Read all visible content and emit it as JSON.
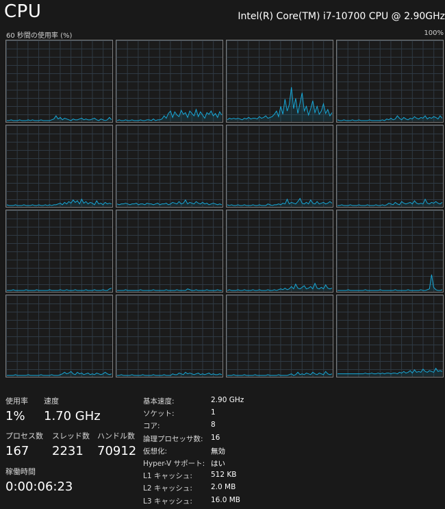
{
  "header": {
    "title": "CPU",
    "model": "Intel(R) Core(TM) i7-10700 CPU @ 2.90GHz",
    "axis_label": "60 秒間の使用率 (%)",
    "axis_max": "100%"
  },
  "colors": {
    "background": "#191919",
    "graph_line": "#17a9d9",
    "graph_border": "#7e7e7e",
    "grid_line": "#2f3a44"
  },
  "core_graphs": [
    [
      0,
      0,
      1,
      0,
      0,
      0,
      1,
      0,
      0,
      0,
      1,
      0,
      1,
      0,
      0,
      0,
      1,
      0,
      0,
      0,
      0,
      1,
      2,
      6,
      2,
      4,
      1,
      3,
      2,
      1,
      0,
      2,
      1,
      1,
      2,
      3,
      1,
      2,
      1,
      1,
      2,
      3,
      1,
      0,
      2,
      1,
      0,
      1,
      4,
      1
    ],
    [
      0,
      1,
      0,
      0,
      1,
      0,
      0,
      1,
      0,
      0,
      0,
      1,
      0,
      0,
      1,
      1,
      0,
      2,
      0,
      1,
      1,
      2,
      6,
      3,
      9,
      12,
      4,
      11,
      7,
      5,
      13,
      8,
      10,
      4,
      12,
      9,
      6,
      14,
      5,
      11,
      7,
      3,
      10,
      8,
      12,
      6,
      9,
      4,
      11,
      7
    ],
    [
      1,
      3,
      2,
      3,
      2,
      3,
      2,
      1,
      3,
      2,
      4,
      2,
      3,
      3,
      2,
      5,
      3,
      4,
      6,
      3,
      4,
      5,
      8,
      12,
      5,
      18,
      8,
      27,
      12,
      20,
      42,
      15,
      28,
      9,
      22,
      35,
      12,
      18,
      7,
      15,
      25,
      10,
      18,
      8,
      12,
      21,
      9,
      14,
      6,
      10
    ],
    [
      1,
      0,
      0,
      1,
      0,
      0,
      0,
      1,
      0,
      0,
      1,
      0,
      0,
      0,
      0,
      1,
      0,
      0,
      0,
      0,
      0,
      1,
      0,
      2,
      1,
      3,
      1,
      2,
      6,
      3,
      1,
      4,
      2,
      1,
      3,
      2,
      5,
      3,
      2,
      4,
      3,
      6,
      2,
      4,
      3,
      5,
      4,
      2,
      6,
      3
    ],
    [
      1,
      0,
      0,
      0,
      1,
      0,
      0,
      0,
      1,
      0,
      0,
      0,
      1,
      0,
      0,
      1,
      0,
      0,
      1,
      0,
      1,
      0,
      1,
      1,
      2,
      3,
      1,
      4,
      2,
      5,
      3,
      7,
      4,
      6,
      2,
      8,
      3,
      5,
      2,
      4,
      3,
      1,
      6,
      2,
      3,
      1,
      4,
      2,
      3,
      2
    ],
    [
      2,
      1,
      2,
      2,
      3,
      2,
      1,
      2,
      2,
      3,
      1,
      2,
      2,
      1,
      3,
      2,
      2,
      1,
      2,
      3,
      1,
      2,
      2,
      3,
      1,
      2,
      4,
      3,
      2,
      5,
      2,
      3,
      7,
      2,
      4,
      3,
      2,
      5,
      3,
      2,
      4,
      2,
      3,
      1,
      2,
      3,
      2,
      1,
      2,
      1
    ],
    [
      1,
      0,
      1,
      0,
      0,
      1,
      0,
      0,
      1,
      0,
      0,
      0,
      1,
      0,
      0,
      1,
      0,
      0,
      0,
      2,
      1,
      0,
      1,
      1,
      2,
      1,
      3,
      2,
      8,
      2,
      4,
      3,
      2,
      5,
      9,
      3,
      2,
      4,
      2,
      7,
      3,
      2,
      5,
      2,
      3,
      4,
      2,
      3,
      5,
      3
    ],
    [
      0,
      0,
      1,
      0,
      0,
      0,
      1,
      0,
      0,
      0,
      1,
      0,
      0,
      0,
      1,
      0,
      0,
      0,
      1,
      0,
      0,
      1,
      0,
      1,
      3,
      2,
      1,
      4,
      2,
      1,
      5,
      3,
      2,
      3,
      4,
      2,
      6,
      3,
      2,
      3,
      2,
      8,
      3,
      2,
      4,
      3,
      5,
      3,
      2,
      4
    ],
    [
      0,
      0,
      0,
      1,
      0,
      0,
      0,
      0,
      0,
      1,
      0,
      0,
      0,
      0,
      1,
      0,
      0,
      0,
      0,
      0,
      1,
      0,
      0,
      0,
      0,
      1,
      0,
      0,
      1,
      0,
      0,
      0,
      1,
      0,
      0,
      0,
      0,
      1,
      0,
      0,
      0,
      1,
      0,
      0,
      0,
      1,
      0,
      0,
      2,
      3
    ],
    [
      0,
      0,
      0,
      0,
      1,
      0,
      0,
      0,
      0,
      0,
      0,
      1,
      0,
      0,
      0,
      0,
      0,
      1,
      0,
      0,
      0,
      0,
      0,
      1,
      0,
      0,
      0,
      0,
      1,
      0,
      0,
      0,
      0,
      2,
      1,
      0,
      0,
      1,
      0,
      0,
      0,
      0,
      1,
      0,
      0,
      0,
      0,
      1,
      0,
      0
    ],
    [
      0,
      1,
      0,
      0,
      0,
      1,
      0,
      0,
      1,
      0,
      0,
      0,
      1,
      0,
      0,
      1,
      0,
      0,
      0,
      1,
      0,
      0,
      1,
      0,
      1,
      2,
      1,
      3,
      1,
      2,
      5,
      2,
      8,
      3,
      2,
      4,
      6,
      2,
      3,
      5,
      2,
      9,
      3,
      2,
      4,
      2,
      7,
      3,
      2,
      3
    ],
    [
      0,
      0,
      0,
      0,
      0,
      1,
      0,
      0,
      0,
      0,
      0,
      0,
      0,
      1,
      0,
      0,
      0,
      0,
      0,
      0,
      1,
      0,
      0,
      0,
      0,
      0,
      0,
      1,
      0,
      0,
      0,
      0,
      0,
      1,
      0,
      0,
      0,
      0,
      0,
      1,
      0,
      0,
      1,
      2,
      20,
      4,
      1,
      0,
      0,
      1
    ],
    [
      0,
      0,
      0,
      0,
      1,
      0,
      0,
      0,
      0,
      0,
      1,
      0,
      0,
      0,
      0,
      0,
      1,
      0,
      0,
      0,
      0,
      1,
      0,
      0,
      0,
      1,
      2,
      4,
      2,
      3,
      5,
      2,
      1,
      4,
      2,
      3,
      1,
      2,
      3,
      1,
      2,
      1,
      3,
      2,
      1,
      2,
      4,
      2,
      1,
      2
    ],
    [
      0,
      0,
      1,
      0,
      0,
      0,
      0,
      1,
      0,
      0,
      0,
      0,
      1,
      0,
      0,
      0,
      0,
      1,
      0,
      0,
      0,
      0,
      1,
      0,
      0,
      0,
      2,
      1,
      1,
      3,
      2,
      1,
      4,
      2,
      3,
      2,
      1,
      2,
      3,
      1,
      2,
      1,
      2,
      3,
      1,
      2,
      1,
      1,
      2,
      1
    ],
    [
      0,
      0,
      0,
      1,
      0,
      0,
      0,
      0,
      1,
      0,
      0,
      0,
      0,
      1,
      0,
      0,
      0,
      0,
      0,
      1,
      0,
      0,
      0,
      0,
      1,
      0,
      0,
      0,
      0,
      1,
      2,
      0,
      1,
      4,
      1,
      2,
      1,
      3,
      2,
      1,
      4,
      2,
      1,
      3,
      2,
      1,
      5,
      2,
      1,
      2
    ],
    [
      2,
      2,
      2,
      2,
      2,
      2,
      2,
      2,
      2,
      2,
      2,
      2,
      2,
      3,
      2,
      2,
      3,
      2,
      2,
      3,
      2,
      3,
      2,
      3,
      3,
      2,
      3,
      3,
      2,
      4,
      3,
      5,
      3,
      4,
      6,
      3,
      7,
      4,
      5,
      4,
      8,
      5,
      4,
      6,
      5,
      4,
      9,
      5,
      6,
      5
    ]
  ],
  "stats": {
    "usage_label": "使用率",
    "usage_value": "1%",
    "speed_label": "速度",
    "speed_value": "1.70 GHz",
    "processes_label": "プロセス数",
    "processes_value": "167",
    "threads_label": "スレッド数",
    "threads_value": "2231",
    "handles_label": "ハンドル数",
    "handles_value": "70912",
    "uptime_label": "稼働時間",
    "uptime_value": "0:00:06:23"
  },
  "specs": [
    {
      "label": "基本速度:",
      "value": "2.90 GHz"
    },
    {
      "label": "ソケット:",
      "value": "1"
    },
    {
      "label": "コア:",
      "value": "8"
    },
    {
      "label": "論理プロセッサ数:",
      "value": "16"
    },
    {
      "label": "仮想化:",
      "value": "無効"
    },
    {
      "label": "Hyper-V サポート:",
      "value": "はい"
    },
    {
      "label": "L1 キャッシュ:",
      "value": "512 KB"
    },
    {
      "label": "L2 キャッシュ:",
      "value": "2.0 MB"
    },
    {
      "label": "L3 キャッシュ:",
      "value": "16.0 MB"
    }
  ]
}
